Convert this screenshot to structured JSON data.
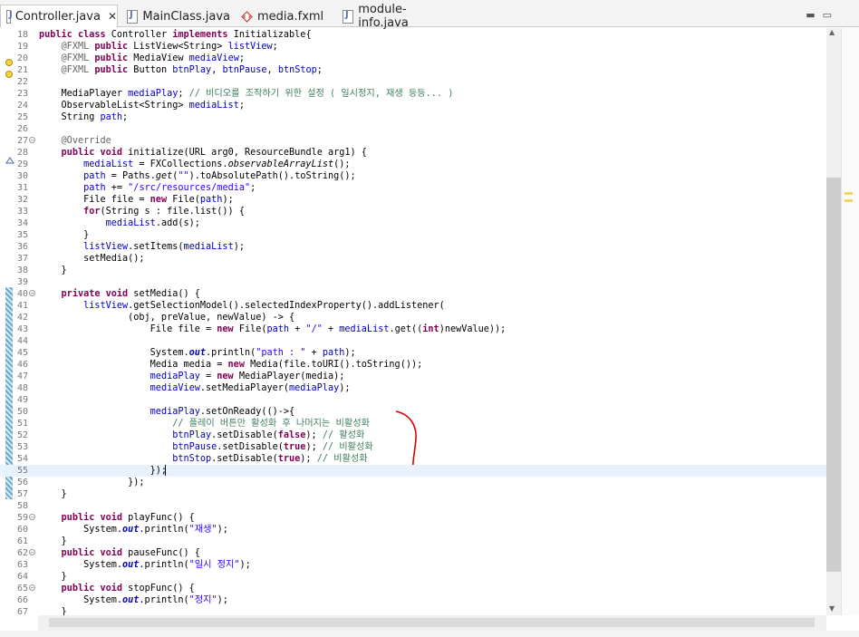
{
  "tabs": [
    {
      "label": "Controller.java",
      "icon": "java-file-icon",
      "active": true,
      "closable": true
    },
    {
      "label": "MainClass.java",
      "icon": "java-file-icon",
      "active": false
    },
    {
      "label": "media.fxml",
      "icon": "fxml-file-icon",
      "active": false
    },
    {
      "label": "module-info.java",
      "icon": "java-file-icon",
      "active": false
    }
  ],
  "colors": {
    "keyword": "#7f0055",
    "annotation": "#646464",
    "field": "#0000c0",
    "comment": "#3f7f5f",
    "string": "#2a00ff",
    "current_line": "#e8f2fe",
    "red_annotation": "#e00000"
  },
  "editor": {
    "current_line": 55,
    "lines": [
      {
        "n": 18,
        "tokens": [
          [
            "kw",
            "public"
          ],
          [
            "",
            " "
          ],
          [
            "kw",
            "class"
          ],
          [
            "",
            " Controller "
          ],
          [
            "kw",
            "implements"
          ],
          [
            "",
            " Initializable{"
          ]
        ]
      },
      {
        "n": 19,
        "tokens": [
          [
            "",
            "    "
          ],
          [
            "an",
            "@FXML"
          ],
          [
            "",
            " "
          ],
          [
            "kw",
            "public"
          ],
          [
            "",
            " ListView<String> "
          ],
          [
            "fd",
            "listView"
          ],
          [
            "",
            ";"
          ]
        ]
      },
      {
        "n": 20,
        "tokens": [
          [
            "",
            "    "
          ],
          [
            "an",
            "@FXML"
          ],
          [
            "",
            " "
          ],
          [
            "kw",
            "public"
          ],
          [
            "",
            " MediaView "
          ],
          [
            "fd",
            "mediaView"
          ],
          [
            "",
            ";"
          ]
        ]
      },
      {
        "n": 21,
        "tokens": [
          [
            "",
            "    "
          ],
          [
            "an",
            "@FXML"
          ],
          [
            "",
            " "
          ],
          [
            "kw",
            "public"
          ],
          [
            "",
            " Button "
          ],
          [
            "fd",
            "btnPlay"
          ],
          [
            "",
            ", "
          ],
          [
            "fd",
            "btnPause"
          ],
          [
            "",
            ", "
          ],
          [
            "fd",
            "btnStop"
          ],
          [
            "",
            ";"
          ]
        ]
      },
      {
        "n": 22,
        "tokens": []
      },
      {
        "n": 23,
        "tokens": [
          [
            "",
            "    MediaPlayer "
          ],
          [
            "fd",
            "mediaPlay"
          ],
          [
            "",
            "; "
          ],
          [
            "cm",
            "// 비디오를 조작하기 위한 설정 ( 일시정지, 재생 등등... )"
          ]
        ]
      },
      {
        "n": 24,
        "tokens": [
          [
            "",
            "    ObservableList<String> "
          ],
          [
            "fd",
            "mediaList"
          ],
          [
            "",
            ";"
          ]
        ]
      },
      {
        "n": 25,
        "tokens": [
          [
            "",
            "    String "
          ],
          [
            "fd",
            "path"
          ],
          [
            "",
            ";"
          ]
        ]
      },
      {
        "n": 26,
        "tokens": []
      },
      {
        "n": 27,
        "fold": true,
        "tokens": [
          [
            "",
            "    "
          ],
          [
            "an",
            "@Override"
          ]
        ]
      },
      {
        "n": 28,
        "tokens": [
          [
            "",
            "    "
          ],
          [
            "kw",
            "public"
          ],
          [
            "",
            " "
          ],
          [
            "kw",
            "void"
          ],
          [
            "",
            " initialize(URL arg0, ResourceBundle arg1) {"
          ]
        ]
      },
      {
        "n": 29,
        "tokens": [
          [
            "",
            "        "
          ],
          [
            "fd",
            "mediaList"
          ],
          [
            "",
            " = FXCollections."
          ],
          [
            "it",
            "observableArrayList"
          ],
          [
            "",
            "();"
          ]
        ]
      },
      {
        "n": 30,
        "tokens": [
          [
            "",
            "        "
          ],
          [
            "fd",
            "path"
          ],
          [
            "",
            " = Paths."
          ],
          [
            "it",
            "get"
          ],
          [
            "",
            "("
          ],
          [
            "st",
            "\"\""
          ],
          [
            "",
            ").toAbsolutePath().toString();"
          ]
        ]
      },
      {
        "n": 31,
        "tokens": [
          [
            "",
            "        "
          ],
          [
            "fd",
            "path"
          ],
          [
            "",
            " += "
          ],
          [
            "st",
            "\"/src/resources/media\""
          ],
          [
            "",
            ";"
          ]
        ]
      },
      {
        "n": 32,
        "tokens": [
          [
            "",
            "        File file = "
          ],
          [
            "kw",
            "new"
          ],
          [
            "",
            " File("
          ],
          [
            "fd",
            "path"
          ],
          [
            "",
            ");"
          ]
        ]
      },
      {
        "n": 33,
        "tokens": [
          [
            "",
            "        "
          ],
          [
            "kw",
            "for"
          ],
          [
            "",
            "(String s : file.list()) {"
          ]
        ]
      },
      {
        "n": 34,
        "tokens": [
          [
            "",
            "            "
          ],
          [
            "fd",
            "mediaList"
          ],
          [
            "",
            ".add(s);"
          ]
        ]
      },
      {
        "n": 35,
        "tokens": [
          [
            "",
            "        }"
          ]
        ]
      },
      {
        "n": 36,
        "tokens": [
          [
            "",
            "        "
          ],
          [
            "fd",
            "listView"
          ],
          [
            "",
            ".setItems("
          ],
          [
            "fd",
            "mediaList"
          ],
          [
            "",
            ");"
          ]
        ]
      },
      {
        "n": 37,
        "tokens": [
          [
            "",
            "        setMedia();"
          ]
        ]
      },
      {
        "n": 38,
        "tokens": [
          [
            "",
            "    }"
          ]
        ]
      },
      {
        "n": 39,
        "tokens": []
      },
      {
        "n": 40,
        "fold": true,
        "tokens": [
          [
            "",
            "    "
          ],
          [
            "kw",
            "private"
          ],
          [
            "",
            " "
          ],
          [
            "kw",
            "void"
          ],
          [
            "",
            " setMedia() {"
          ]
        ]
      },
      {
        "n": 41,
        "tokens": [
          [
            "",
            "        "
          ],
          [
            "fd",
            "listView"
          ],
          [
            "",
            ".getSelectionModel().selectedIndexProperty().addListener("
          ]
        ]
      },
      {
        "n": 42,
        "tokens": [
          [
            "",
            "                (obj, preValue, newValue) -> {"
          ]
        ]
      },
      {
        "n": 43,
        "tokens": [
          [
            "",
            "                    File file = "
          ],
          [
            "kw",
            "new"
          ],
          [
            "",
            " File("
          ],
          [
            "fd",
            "path"
          ],
          [
            "",
            " + "
          ],
          [
            "st",
            "\"/\""
          ],
          [
            "",
            " + "
          ],
          [
            "fd",
            "mediaList"
          ],
          [
            "",
            ".get(("
          ],
          [
            "kw",
            "int"
          ],
          [
            "",
            ")newValue));"
          ]
        ]
      },
      {
        "n": 44,
        "tokens": []
      },
      {
        "n": 45,
        "tokens": [
          [
            "",
            "                    System."
          ],
          [
            "itf",
            "out"
          ],
          [
            "",
            ".println("
          ],
          [
            "st",
            "\"path : \""
          ],
          [
            "",
            " + "
          ],
          [
            "fd",
            "path"
          ],
          [
            "",
            ");"
          ]
        ]
      },
      {
        "n": 46,
        "tokens": [
          [
            "",
            "                    Media media = "
          ],
          [
            "kw",
            "new"
          ],
          [
            "",
            " Media(file.toURI().toString());"
          ]
        ]
      },
      {
        "n": 47,
        "tokens": [
          [
            "",
            "                    "
          ],
          [
            "fd",
            "mediaPlay"
          ],
          [
            "",
            " = "
          ],
          [
            "kw",
            "new"
          ],
          [
            "",
            " MediaPlayer(media);"
          ]
        ]
      },
      {
        "n": 48,
        "tokens": [
          [
            "",
            "                    "
          ],
          [
            "fd",
            "mediaView"
          ],
          [
            "",
            ".setMediaPlayer("
          ],
          [
            "fd",
            "mediaPlay"
          ],
          [
            "",
            ");"
          ]
        ]
      },
      {
        "n": 49,
        "tokens": []
      },
      {
        "n": 50,
        "tokens": [
          [
            "",
            "                    "
          ],
          [
            "fd",
            "mediaPlay"
          ],
          [
            "",
            ".setOnReady(()->{"
          ]
        ]
      },
      {
        "n": 51,
        "tokens": [
          [
            "",
            "                        "
          ],
          [
            "cm",
            "// 플레이 버튼만 활성화 후 나머지는 비활성화"
          ]
        ]
      },
      {
        "n": 52,
        "tokens": [
          [
            "",
            "                        "
          ],
          [
            "fd",
            "btnPlay"
          ],
          [
            "",
            ".setDisable("
          ],
          [
            "kw",
            "false"
          ],
          [
            "",
            "); "
          ],
          [
            "cm",
            "// 활성화"
          ]
        ]
      },
      {
        "n": 53,
        "tokens": [
          [
            "",
            "                        "
          ],
          [
            "fd",
            "btnPause"
          ],
          [
            "",
            ".setDisable("
          ],
          [
            "kw",
            "true"
          ],
          [
            "",
            "); "
          ],
          [
            "cm",
            "// 비활성화"
          ]
        ]
      },
      {
        "n": 54,
        "tokens": [
          [
            "",
            "                        "
          ],
          [
            "fd",
            "btnStop"
          ],
          [
            "",
            ".setDisable("
          ],
          [
            "kw",
            "true"
          ],
          [
            "",
            "); "
          ],
          [
            "cm",
            "// 비활성화"
          ]
        ]
      },
      {
        "n": 55,
        "tokens": [
          [
            "",
            "                    });"
          ]
        ]
      },
      {
        "n": 56,
        "tokens": [
          [
            "",
            "                });"
          ]
        ]
      },
      {
        "n": 57,
        "tokens": [
          [
            "",
            "    }"
          ]
        ]
      },
      {
        "n": 58,
        "tokens": []
      },
      {
        "n": 59,
        "fold": true,
        "tokens": [
          [
            "",
            "    "
          ],
          [
            "kw",
            "public"
          ],
          [
            "",
            " "
          ],
          [
            "kw",
            "void"
          ],
          [
            "",
            " playFunc() {"
          ]
        ]
      },
      {
        "n": 60,
        "tokens": [
          [
            "",
            "        System."
          ],
          [
            "itf",
            "out"
          ],
          [
            "",
            ".println("
          ],
          [
            "st",
            "\"재생\""
          ],
          [
            "",
            ");"
          ]
        ]
      },
      {
        "n": 61,
        "tokens": [
          [
            "",
            "    }"
          ]
        ]
      },
      {
        "n": 62,
        "fold": true,
        "tokens": [
          [
            "",
            "    "
          ],
          [
            "kw",
            "public"
          ],
          [
            "",
            " "
          ],
          [
            "kw",
            "void"
          ],
          [
            "",
            " pauseFunc() {"
          ]
        ]
      },
      {
        "n": 63,
        "tokens": [
          [
            "",
            "        System."
          ],
          [
            "itf",
            "out"
          ],
          [
            "",
            ".println("
          ],
          [
            "st",
            "\"일시 정지\""
          ],
          [
            "",
            ");"
          ]
        ]
      },
      {
        "n": 64,
        "tokens": [
          [
            "",
            "    }"
          ]
        ]
      },
      {
        "n": 65,
        "fold": true,
        "tokens": [
          [
            "",
            "    "
          ],
          [
            "kw",
            "public"
          ],
          [
            "",
            " "
          ],
          [
            "kw",
            "void"
          ],
          [
            "",
            " stopFunc() {"
          ]
        ]
      },
      {
        "n": 66,
        "tokens": [
          [
            "",
            "        System."
          ],
          [
            "itf",
            "out"
          ],
          [
            "",
            ".println("
          ],
          [
            "st",
            "\"정지\""
          ],
          [
            "",
            ");"
          ]
        ]
      },
      {
        "n": 67,
        "tokens": [
          [
            "",
            "    }"
          ]
        ]
      }
    ]
  }
}
